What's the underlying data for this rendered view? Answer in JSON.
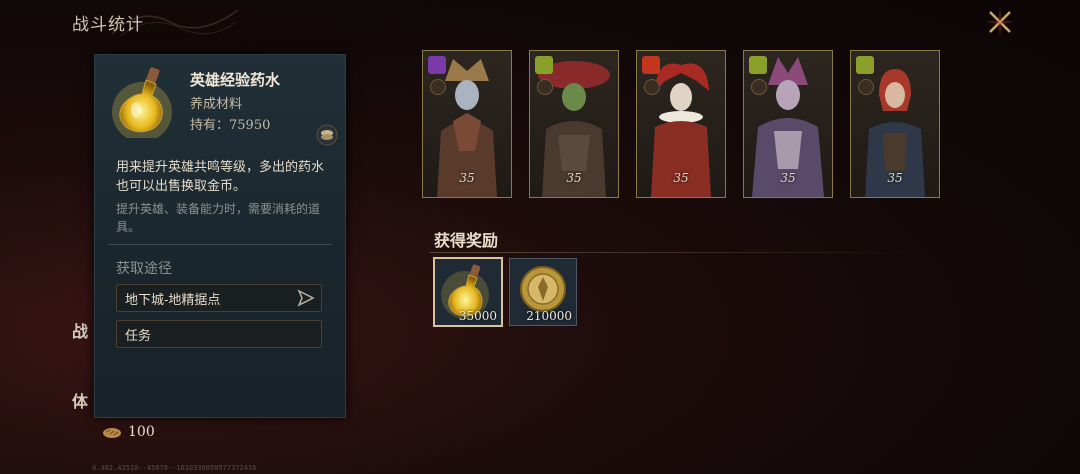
{
  "header": {
    "title": "战斗统计"
  },
  "side_labels": [
    "战",
    "体"
  ],
  "popup": {
    "item_name": "英雄经验药水",
    "category": "养成材料",
    "owned": "持有：75950",
    "description": "用来提升英雄共鸣等级，多出的药水也可以出售换取金币。",
    "note": "提升英雄、装备能力时，需要消耗的道具。",
    "sources_title": "获取途径",
    "sources": [
      "地下城-地精据点",
      "任务"
    ]
  },
  "footer": {
    "currency_value": "100",
    "version": "0.302.43510--45870--1610336050577372416"
  },
  "heroes": [
    {
      "level": "35",
      "element_color": "#7a3aa8",
      "role_icon": "shield-icon"
    },
    {
      "level": "35",
      "element_color": "#8aa02a",
      "role_icon": "sword-icon"
    },
    {
      "level": "35",
      "element_color": "#c2361e",
      "role_icon": "staff-icon"
    },
    {
      "level": "35",
      "element_color": "#8aa02a",
      "role_icon": "sword-icon"
    },
    {
      "level": "35",
      "element_color": "#8aa02a",
      "role_icon": "shield-icon"
    }
  ],
  "rewards": {
    "title": "获得奖励",
    "items": [
      {
        "icon": "potion-icon",
        "count": "35000",
        "selected": true
      },
      {
        "icon": "gold-coin-icon",
        "count": "210000",
        "selected": false
      }
    ]
  }
}
